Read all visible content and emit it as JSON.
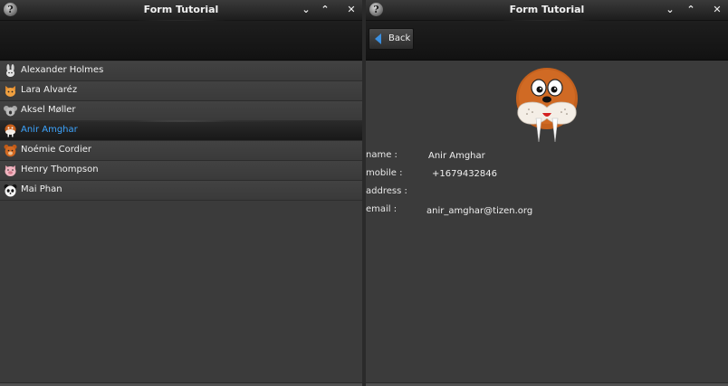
{
  "left_window": {
    "title": "Form Tutorial",
    "help_glyph": "?",
    "controls": [
      "⌄",
      "⌃",
      "✕"
    ],
    "contacts": [
      {
        "name": "Alexander Holmes",
        "icon": "rabbit-icon"
      },
      {
        "name": "Lara Alvaréz",
        "icon": "cat-icon"
      },
      {
        "name": "Aksel Møller",
        "icon": "koala-icon"
      },
      {
        "name": "Anir Amghar",
        "icon": "walrus-icon",
        "selected": true
      },
      {
        "name": "Noémie Cordier",
        "icon": "bear-icon"
      },
      {
        "name": "Henry Thompson",
        "icon": "pig-icon"
      },
      {
        "name": "Mai Phan",
        "icon": "panda-icon"
      }
    ]
  },
  "right_window": {
    "title": "Form Tutorial",
    "help_glyph": "?",
    "controls": [
      "⌄",
      "⌃",
      "✕"
    ],
    "back_label": "Back",
    "avatar_icon": "walrus-icon",
    "details": {
      "name_label": "name :",
      "name_value": "Anir Amghar",
      "mobile_label": "mobile :",
      "mobile_value": "+1679432846",
      "address_label": "address :",
      "address_value": "",
      "email_label": "email :",
      "email_value": "anir_amghar@tizen.org"
    }
  },
  "colors": {
    "selected_text": "#3da5ff",
    "window_bg": "#3b3b3b",
    "titlebar_bg": "#1d1d1d"
  }
}
